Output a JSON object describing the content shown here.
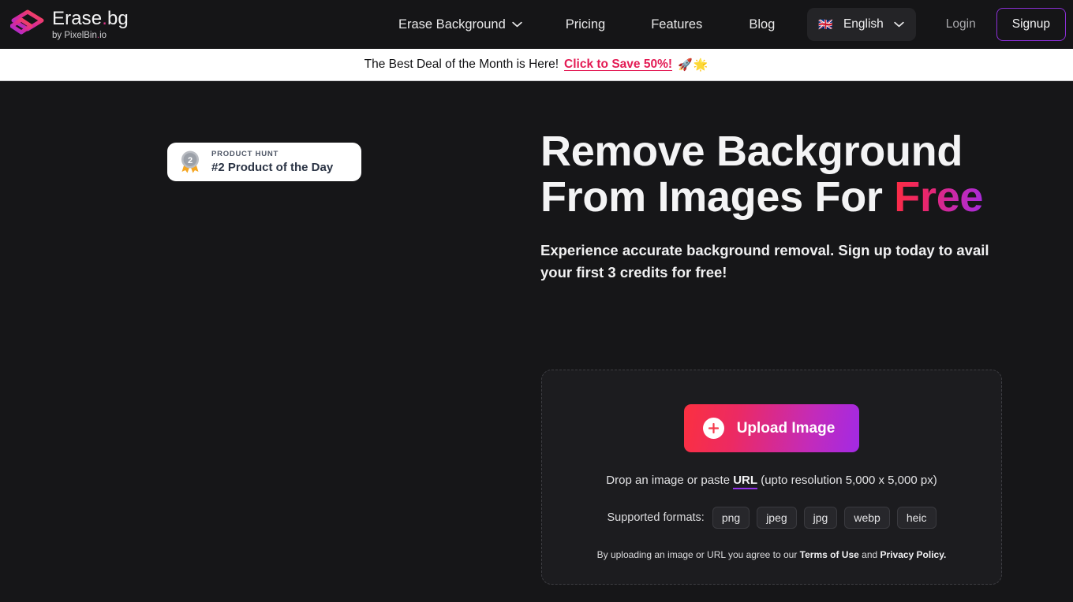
{
  "header": {
    "brand": {
      "name_main": "Erase",
      "name_dot": ".",
      "name_ext": "bg",
      "sub_prefix": "by PixelBin",
      "sub_dot": ".",
      "sub_ext": "io"
    },
    "nav": [
      {
        "label": "Erase Background",
        "has_chevron": true
      },
      {
        "label": "Pricing",
        "has_chevron": false
      },
      {
        "label": "Features",
        "has_chevron": false
      },
      {
        "label": "Blog",
        "has_chevron": false
      }
    ],
    "language": {
      "flag": "🇬🇧",
      "label": "English"
    },
    "login_label": "Login",
    "signup_label": "Signup",
    "signup_border_color": "#8b2fd6"
  },
  "promo": {
    "text": "The Best Deal of the Month is Here!",
    "link": "Click to Save 50%!",
    "emoji": "🚀🌟",
    "link_color": "#e31b54",
    "background": "#ffffff"
  },
  "product_hunt": {
    "kicker": "PRODUCT HUNT",
    "title": "#2 Product of the Day",
    "rank": "2"
  },
  "hero": {
    "title_line1": "Remove Background",
    "title_line2_prefix": "From Images For ",
    "title_highlight": "Free",
    "subtitle": "Experience accurate background removal. Sign up today to avail your first 3 credits for free!",
    "highlight_gradient_from": "#ff2d3f",
    "highlight_gradient_to": "#a22ae0"
  },
  "upload": {
    "button_label": "Upload Image",
    "drop_prefix": "Drop an image or paste ",
    "drop_url_label": "URL",
    "drop_suffix": " (upto resolution 5,000 x 5,000 px)",
    "formats_label": "Supported formats:",
    "formats": [
      "png",
      "jpeg",
      "jpg",
      "webp",
      "heic"
    ],
    "terms_prefix": "By uploading an image or URL you agree to our ",
    "terms_link1": "Terms of Use",
    "terms_mid": " and ",
    "terms_link2": "Privacy Policy.",
    "button_gradient_from": "#fb3040",
    "button_gradient_to": "#a22ae5"
  }
}
